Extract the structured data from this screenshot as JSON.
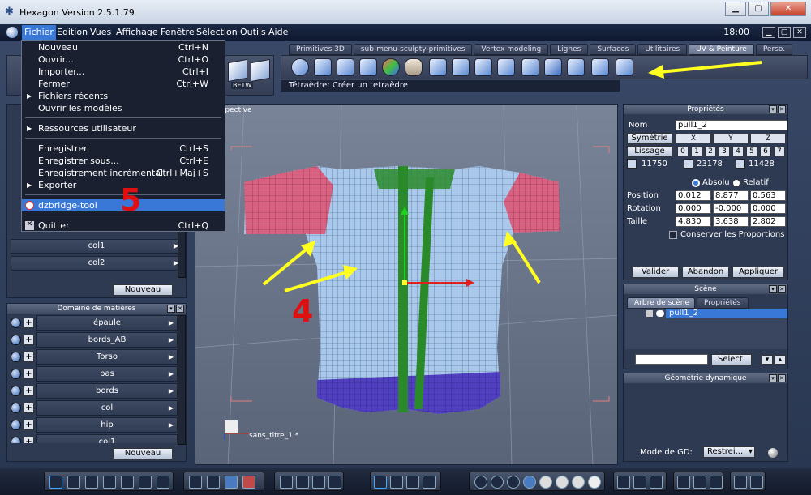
{
  "window": {
    "title": "Hexagon Version 2.5.1.79",
    "min": "▁",
    "max": "▢",
    "close": "✕"
  },
  "menubar": {
    "items": [
      "Fichier",
      "Edition",
      "Vues",
      "Affichage",
      "Fenêtre",
      "Sélection",
      "Outils",
      "Aide"
    ],
    "clock": "18:00",
    "controls": [
      "▁",
      "▢",
      "✕"
    ]
  },
  "file_menu": {
    "items": [
      {
        "label": "Nouveau",
        "shortcut": "Ctrl+N"
      },
      {
        "label": "Ouvrir...",
        "shortcut": "Ctrl+O"
      },
      {
        "label": "Importer...",
        "shortcut": "Ctrl+I"
      },
      {
        "label": "Fermer",
        "shortcut": "Ctrl+W"
      },
      {
        "label": "Fichiers récents",
        "shortcut": ""
      },
      {
        "label": "Ouvrir les modèles",
        "shortcut": ""
      },
      {
        "label": "Ressources utilisateur",
        "shortcut": ""
      },
      {
        "label": "Enregistrer",
        "shortcut": "Ctrl+S"
      },
      {
        "label": "Enregistrer sous...",
        "shortcut": "Ctrl+E"
      },
      {
        "label": "Enregistrement incrémental",
        "shortcut": "Ctrl+Maj+S"
      },
      {
        "label": "Exporter",
        "shortcut": ""
      },
      {
        "label": "dzbridge-tool",
        "shortcut": ""
      },
      {
        "label": "Quitter",
        "shortcut": "Ctrl+Q"
      }
    ]
  },
  "tabs": [
    "Primitives 3D",
    "sub-menu-sculpty-primitives",
    "Vertex modeling",
    "Lignes",
    "Surfaces",
    "Utilitaires",
    "UV & Peinture",
    "Perso."
  ],
  "status_text": "Tétraèdre: Créer un tetraèdre",
  "left_toolbar": {
    "betw": "BETW"
  },
  "left_panel": {
    "rows": [
      "col1",
      "col2"
    ],
    "new_button": "Nouveau"
  },
  "domain_panel": {
    "title": "Domaine de matières",
    "rows": [
      "épaule",
      "bords_AB",
      "Torso",
      "bas",
      "bords",
      "col",
      "hip",
      "col1"
    ],
    "new_button": "Nouveau"
  },
  "viewport": {
    "label": "rspective",
    "scene_name": "sans_titre_1 *"
  },
  "properties": {
    "title": "Propriétés",
    "name_label": "Nom",
    "name_value": "pull1_2",
    "symmetry_label": "Symétrie",
    "smoothing_label": "Lissage",
    "axes": [
      "X",
      "Y",
      "Z"
    ],
    "levels": [
      "0",
      "1",
      "2",
      "3",
      "4",
      "5",
      "6",
      "7"
    ],
    "counts": [
      "11750",
      "23178",
      "11428"
    ],
    "absolute_label": "Absolu",
    "relative_label": "Relatif",
    "position_label": "Position",
    "rotation_label": "Rotation",
    "size_label": "Taille",
    "position": [
      "0.012",
      "8.877",
      "0.563"
    ],
    "rotation": [
      "0.000",
      "-0.000",
      "0.000"
    ],
    "size": [
      "4.830",
      "3.638",
      "2.802"
    ],
    "keep_proportions": "Conserver les Proportions",
    "validate": "Valider",
    "abandon": "Abandon",
    "apply": "Appliquer"
  },
  "scene": {
    "title": "Scène",
    "tab_tree": "Arbre de scène",
    "tab_props": "Propriétés",
    "item": "pull1_2",
    "select_button": "Select."
  },
  "geometry": {
    "title": "Géométrie dynamique",
    "mode_label": "Mode de GD:",
    "mode_value": "Restrei..."
  },
  "annotations": {
    "five": "5",
    "four": "4"
  },
  "colors": {
    "accent": "#3a78d8",
    "annotation_red": "#e01010",
    "arrow_yellow": "#ffff20",
    "shirt_blue": "#a8c8ec",
    "sleeve_pink": "#d86080",
    "hem_purple": "#5040c0",
    "placket_green": "#2a8a2a"
  }
}
